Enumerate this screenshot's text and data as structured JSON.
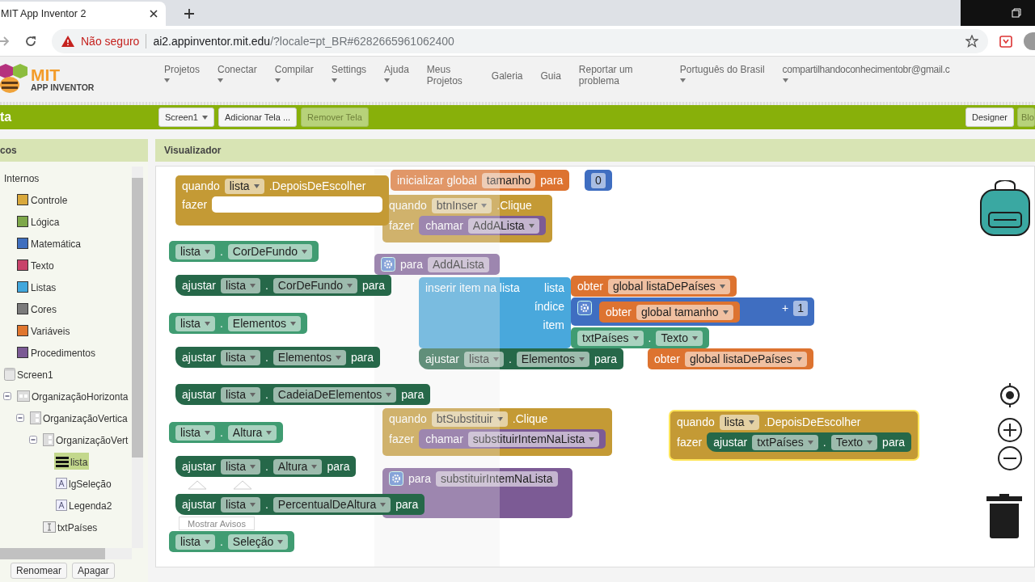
{
  "browser": {
    "tab_title": "MIT App Inventor 2",
    "security": "Não seguro",
    "url_host": "ai2.appinventor.mit.edu",
    "url_path": "/?locale=pt_BR#6282665961062400"
  },
  "app_header": {
    "logo_top": "MIT",
    "logo_bottom": "APP INVENTOR",
    "menu": [
      {
        "label": "Projetos",
        "dropdown": true
      },
      {
        "label": "Conectar",
        "dropdown": true
      },
      {
        "label": "Compilar",
        "dropdown": true
      },
      {
        "label": "Settings",
        "dropdown": true
      },
      {
        "label": "Ajuda",
        "dropdown": true
      },
      {
        "label": "Meus Projetos",
        "dropdown": false
      },
      {
        "label": "Galeria",
        "dropdown": false
      },
      {
        "label": "Guia",
        "dropdown": false
      },
      {
        "label": "Reportar um problema",
        "dropdown": false
      },
      {
        "label": "Português do Brasil",
        "dropdown": true
      },
      {
        "label": "compartilhandoconhecimentobr@gmail.c",
        "dropdown": true
      }
    ]
  },
  "toolbar": {
    "project_title": "ta",
    "screen_buttons": [
      {
        "label": "Screen1",
        "dropdown": true,
        "disabled": false
      },
      {
        "label": "Adicionar Tela ...",
        "dropdown": false,
        "disabled": false
      },
      {
        "label": "Remover Tela",
        "dropdown": false,
        "disabled": true
      }
    ],
    "view_buttons": [
      {
        "label": "Designer",
        "disabled": false
      },
      {
        "label": "Blo",
        "disabled": true
      }
    ]
  },
  "blocks_panel": {
    "title": "cos",
    "tree": [
      {
        "label": "Internos",
        "selected": false,
        "children": [
          {
            "label": "Controle",
            "color": "#d9a93c",
            "selected": false
          },
          {
            "label": "Lógica",
            "color": "#7ea84a",
            "selected": false
          },
          {
            "label": "Matemática",
            "color": "#3f6fbe",
            "selected": false
          },
          {
            "label": "Texto",
            "color": "#c8436a",
            "selected": false
          },
          {
            "label": "Listas",
            "color": "#42a7dc",
            "selected": false
          },
          {
            "label": "Cores",
            "color": "#7b7b7b",
            "selected": false
          },
          {
            "label": "Variáveis",
            "color": "#e0762e",
            "selected": false
          },
          {
            "label": "Procedimentos",
            "color": "#7b5a94",
            "selected": false
          }
        ]
      },
      {
        "label": "Screen1",
        "kind": "screen",
        "selected": false,
        "children": [
          {
            "label": "OrganizaçãoHorizonta",
            "kind": "horizontal",
            "expanded": true,
            "selected": false,
            "children": [
              {
                "label": "OrganizaçãoVertica",
                "kind": "vertical",
                "expanded": true,
                "selected": false,
                "children": [
                  {
                    "label": "OrganizaçãoVert",
                    "kind": "vertical",
                    "expanded": true,
                    "selected": false,
                    "children": [
                      {
                        "label": "lista",
                        "kind": "listpicker",
                        "selected": true
                      },
                      {
                        "label": "lgSeleção",
                        "kind": "label",
                        "selected": false
                      },
                      {
                        "label": "Legenda2",
                        "kind": "label",
                        "selected": false
                      }
                    ]
                  },
                  {
                    "label": "txtPaíses",
                    "kind": "textbox",
                    "selected": false
                  }
                ]
              }
            ]
          }
        ]
      }
    ],
    "buttons": [
      "Renomear",
      "Apagar"
    ]
  },
  "viewer": {
    "title": "Visualizador",
    "warnings_button": "Mostrar Avisos",
    "blocks": [
      {
        "kind": "event",
        "selected": false,
        "empty": true,
        "rows": [
          [
            {
              "kind": "word",
              "text": "quando"
            },
            {
              "kind": "dropdown",
              "text": "lista"
            },
            {
              "kind": "word",
              "text": ".DepoisDeEscolher"
            }
          ],
          [
            {
              "kind": "word",
              "text": "fazer"
            }
          ]
        ]
      },
      {
        "kind": "getter",
        "selected": false,
        "rows": [
          [
            {
              "kind": "dropdown",
              "text": "lista"
            },
            {
              "kind": "word",
              "text": "."
            },
            {
              "kind": "dropdown",
              "text": "CorDeFundo"
            }
          ]
        ]
      },
      {
        "kind": "setter",
        "selected": false,
        "rows": [
          [
            {
              "kind": "word",
              "text": "ajustar"
            },
            {
              "kind": "dropdown",
              "text": "lista"
            },
            {
              "kind": "word",
              "text": "."
            },
            {
              "kind": "dropdown",
              "text": "CorDeFundo"
            },
            {
              "kind": "word",
              "text": "para"
            }
          ]
        ]
      },
      {
        "kind": "getter",
        "selected": false,
        "rows": [
          [
            {
              "kind": "dropdown",
              "text": "lista"
            },
            {
              "kind": "word",
              "text": "."
            },
            {
              "kind": "dropdown",
              "text": "Elementos"
            }
          ]
        ]
      },
      {
        "kind": "setter",
        "selected": false,
        "rows": [
          [
            {
              "kind": "word",
              "text": "ajustar"
            },
            {
              "kind": "dropdown",
              "text": "lista"
            },
            {
              "kind": "word",
              "text": "."
            },
            {
              "kind": "dropdown",
              "text": "Elementos"
            },
            {
              "kind": "word",
              "text": "para"
            }
          ]
        ]
      },
      {
        "kind": "setter",
        "selected": false,
        "rows": [
          [
            {
              "kind": "word",
              "text": "ajustar"
            },
            {
              "kind": "dropdown",
              "text": "lista"
            },
            {
              "kind": "word",
              "text": "."
            },
            {
              "kind": "dropdown",
              "text": "CadeiaDeElementos"
            },
            {
              "kind": "word",
              "text": "para"
            }
          ]
        ]
      },
      {
        "kind": "getter",
        "selected": false,
        "rows": [
          [
            {
              "kind": "dropdown",
              "text": "lista"
            },
            {
              "kind": "word",
              "text": "."
            },
            {
              "kind": "dropdown",
              "text": "Altura"
            }
          ]
        ]
      },
      {
        "kind": "setter",
        "selected": false,
        "rows": [
          [
            {
              "kind": "word",
              "text": "ajustar"
            },
            {
              "kind": "dropdown",
              "text": "lista"
            },
            {
              "kind": "word",
              "text": "."
            },
            {
              "kind": "dropdown",
              "text": "Altura"
            },
            {
              "kind": "word",
              "text": "para"
            }
          ]
        ]
      },
      {
        "kind": "setter",
        "selected": false,
        "rows": [
          [
            {
              "kind": "word",
              "text": "ajustar"
            },
            {
              "kind": "dropdown",
              "text": "lista"
            },
            {
              "kind": "word",
              "text": "."
            },
            {
              "kind": "dropdown",
              "text": "PercentualDeAltura"
            },
            {
              "kind": "word",
              "text": "para"
            }
          ]
        ]
      },
      {
        "kind": "getter",
        "selected": false,
        "rows": [
          [
            {
              "kind": "dropdown",
              "text": "lista"
            },
            {
              "kind": "word",
              "text": "."
            },
            {
              "kind": "dropdown",
              "text": "Seleção"
            }
          ]
        ]
      },
      {
        "kind": "variable",
        "selected": false,
        "rows": [
          [
            {
              "kind": "word",
              "text": "inicializar global"
            },
            {
              "kind": "field",
              "text": "tamanho"
            },
            {
              "kind": "word",
              "text": "para"
            }
          ]
        ]
      },
      {
        "kind": "math",
        "selected": false,
        "rows": [
          [
            {
              "kind": "number",
              "text": "0"
            }
          ]
        ]
      },
      {
        "kind": "event",
        "selected": false,
        "empty": false,
        "rows": [
          [
            {
              "kind": "word",
              "text": "quando"
            },
            {
              "kind": "dropdown",
              "text": "btnInser"
            },
            {
              "kind": "word",
              "text": ".Clique"
            }
          ],
          [
            {
              "kind": "word",
              "text": "fazer"
            }
          ]
        ],
        "body": {
          "kind": "call",
          "selected": false,
          "rows": [
            [
              {
                "kind": "word",
                "text": "chamar"
              },
              {
                "kind": "dropdown",
                "text": "AddALista"
              }
            ]
          ]
        }
      },
      {
        "kind": "procedure",
        "selected": false,
        "rows": [
          [
            {
              "kind": "gear"
            },
            {
              "kind": "word",
              "text": "para"
            },
            {
              "kind": "field",
              "text": "AddALista"
            }
          ]
        ]
      },
      {
        "kind": "list",
        "selected": false,
        "rows": [
          [
            {
              "kind": "word",
              "text": "inserir item na lista"
            },
            {
              "kind": "word",
              "text": "lista"
            }
          ],
          [
            {
              "kind": "word",
              "text": "índice"
            }
          ],
          [
            {
              "kind": "word",
              "text": "item"
            }
          ]
        ]
      },
      {
        "kind": "variable",
        "selected": false,
        "rows": [
          [
            {
              "kind": "word",
              "text": "obter"
            },
            {
              "kind": "dropdown",
              "text": "global listaDePaíses"
            }
          ]
        ]
      },
      {
        "kind": "math",
        "selected": false,
        "rows": [
          [
            {
              "kind": "gear"
            },
            {
              "kind": "word",
              "text": "+"
            },
            {
              "kind": "number",
              "text": "1"
            }
          ]
        ]
      },
      {
        "kind": "variable",
        "selected": false,
        "rows": [
          [
            {
              "kind": "word",
              "text": "obter"
            },
            {
              "kind": "dropdown",
              "text": "global tamanho"
            }
          ]
        ]
      },
      {
        "kind": "getter",
        "selected": false,
        "rows": [
          [
            {
              "kind": "dropdown",
              "text": "txtPaíses"
            },
            {
              "kind": "word",
              "text": "."
            },
            {
              "kind": "dropdown",
              "text": "Texto"
            }
          ]
        ]
      },
      {
        "kind": "setter",
        "selected": false,
        "rows": [
          [
            {
              "kind": "word",
              "text": "ajustar"
            },
            {
              "kind": "dropdown",
              "text": "lista"
            },
            {
              "kind": "word",
              "text": "."
            },
            {
              "kind": "dropdown",
              "text": "Elementos"
            },
            {
              "kind": "word",
              "text": "para"
            }
          ]
        ]
      },
      {
        "kind": "variable",
        "selected": false,
        "rows": [
          [
            {
              "kind": "word",
              "text": "obter"
            },
            {
              "kind": "dropdown",
              "text": "global listaDePaíses"
            }
          ]
        ]
      },
      {
        "kind": "event",
        "selected": false,
        "empty": false,
        "rows": [
          [
            {
              "kind": "word",
              "text": "quando"
            },
            {
              "kind": "dropdown",
              "text": "btSubstituir"
            },
            {
              "kind": "word",
              "text": ".Clique"
            }
          ],
          [
            {
              "kind": "word",
              "text": "fazer"
            }
          ]
        ],
        "body": {
          "kind": "call",
          "selected": false,
          "rows": [
            [
              {
                "kind": "word",
                "text": "chamar"
              },
              {
                "kind": "dropdown",
                "text": "substituirIntemNaLista"
              }
            ]
          ]
        }
      },
      {
        "kind": "procedure",
        "selected": false,
        "rows": [
          [
            {
              "kind": "gear"
            },
            {
              "kind": "word",
              "text": "para"
            },
            {
              "kind": "field",
              "text": "substituirIntemNaLista"
            }
          ]
        ]
      },
      {
        "kind": "event",
        "selected": true,
        "empty": false,
        "rows": [
          [
            {
              "kind": "word",
              "text": "quando"
            },
            {
              "kind": "dropdown",
              "text": "lista"
            },
            {
              "kind": "word",
              "text": ".DepoisDeEscolher"
            }
          ],
          [
            {
              "kind": "word",
              "text": "fazer"
            }
          ]
        ],
        "body": {
          "kind": "setter",
          "selected": false,
          "rows": [
            [
              {
                "kind": "word",
                "text": "ajustar"
              },
              {
                "kind": "dropdown",
                "text": "txtPaíses"
              },
              {
                "kind": "word",
                "text": "."
              },
              {
                "kind": "dropdown",
                "text": "Texto"
              },
              {
                "kind": "word",
                "text": "para"
              }
            ]
          ]
        }
      }
    ]
  }
}
